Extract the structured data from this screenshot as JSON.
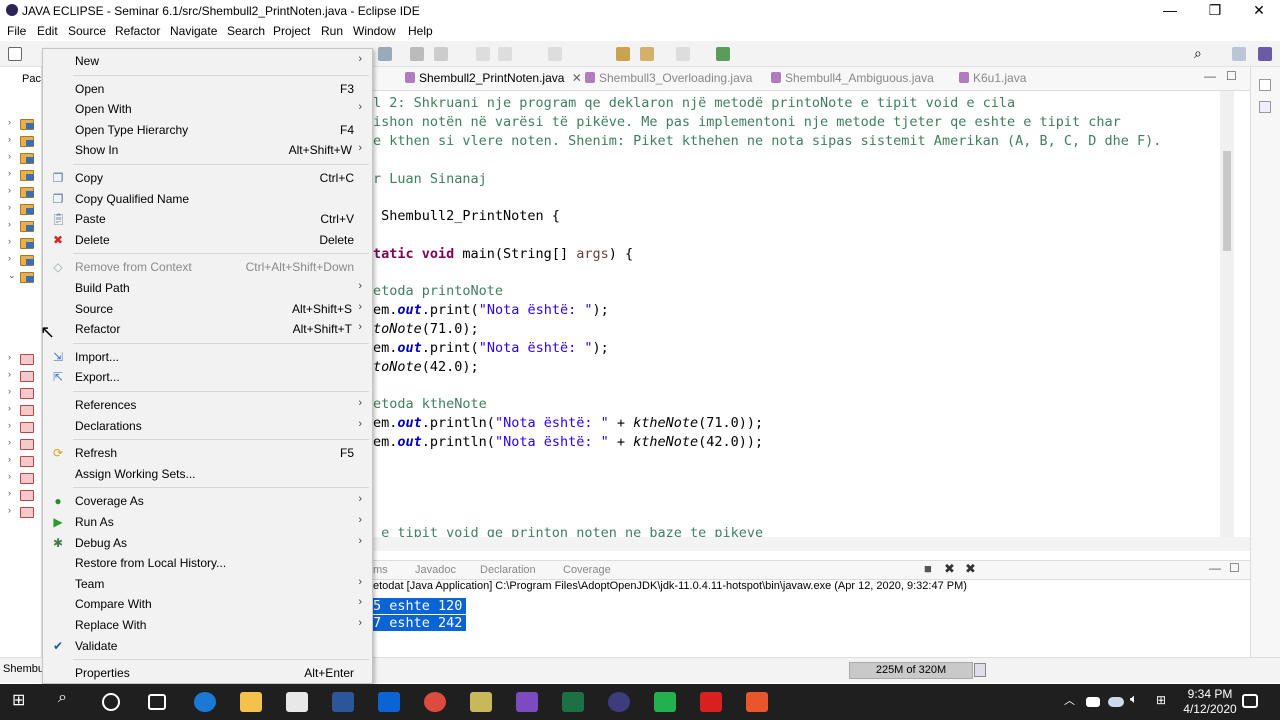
{
  "window": {
    "title": "JAVA ECLIPSE - Seminar 6.1/src/Shembull2_PrintNoten.java - Eclipse IDE",
    "minimize": "—",
    "restore": "❐",
    "close": "✕"
  },
  "menubar": [
    "File",
    "Edit",
    "Source",
    "Refactor",
    "Navigate",
    "Search",
    "Project",
    "Run",
    "Window",
    "Help"
  ],
  "left_panel": {
    "tab_label": "Pac",
    "status_label": "Shembu"
  },
  "editor_tabs": [
    {
      "label": "Shembull2_PrintNoten.java",
      "close": "✕"
    },
    {
      "label": "Shembull3_Overloading.java"
    },
    {
      "label": "Shembull4_Ambiguous.java"
    },
    {
      "label": "K6u1.java"
    }
  ],
  "code": {
    "line1": "l 2: Shkruani nje program qe deklaron një metodë printoNote e tipit void e cila",
    "line2": "ishon notën në varësi të pikëve. Me pas implementoni nje metode tjeter qe eshte e tipit char",
    "line3": "e kthen si vlere noten. Shenim: Piket kthehen ne nota sipas sistemit Amerikan (A, B, C, D dhe F).",
    "author": "r Luan Sinanaj",
    "class_decl": " Shembull2_PrintNoten {",
    "main_kw": "tatic void",
    "main_rest": " main(String[] ",
    "main_args": "args",
    "main_end": ") {",
    "comment1": "etoda printoNote",
    "sys1_a": "em.",
    "sys1_out": "out",
    "sys1_b": ".print(",
    "sys1_str": "\"Nota është: \"",
    "sys1_c": ");",
    "call1_name": "toNote",
    "call1_args": "(71.0);",
    "sys2_a": "em.",
    "sys2_out": "out",
    "sys2_b": ".print(",
    "sys2_str": "\"Nota është: \"",
    "sys2_c": ");",
    "call2_name": "toNote",
    "call2_args": "(42.0);",
    "comment2": "etoda ktheNote",
    "sys3_a": "em.",
    "sys3_out": "out",
    "sys3_b": ".println(",
    "sys3_str": "\"Nota është: \"",
    "sys3_c": " + ",
    "sys3_fn": "ktheNote",
    "sys3_d": "(71.0));",
    "sys4_a": "em.",
    "sys4_out": "out",
    "sys4_b": ".println(",
    "sys4_str": "\"Nota është: \"",
    "sys4_c": " + ",
    "sys4_fn": "ktheNote",
    "sys4_d": "(42.0));",
    "partial_bottom": " e tipit void qe printon noten ne baze te pikeve"
  },
  "console_tabs": [
    "ms",
    "Javadoc",
    "Declaration",
    "Coverage"
  ],
  "console_header": "etodat [Java Application] C:\\Program Files\\AdoptOpenJDK\\jdk-11.0.4.11-hotspot\\bin\\javaw.exe (Apr 12, 2020, 9:32:47 PM)",
  "console_lines": [
    "5 eshte 120",
    "7 eshte 242"
  ],
  "memory": "225M of 320M",
  "context_menu": [
    {
      "label": "New",
      "accel": "",
      "submenu": true,
      "icon": ""
    },
    {
      "sep": true
    },
    {
      "label": "Open",
      "accel": "F3",
      "submenu": false,
      "icon": ""
    },
    {
      "label": "Open With",
      "accel": "",
      "submenu": true,
      "icon": ""
    },
    {
      "label": "Open Type Hierarchy",
      "accel": "F4",
      "submenu": false,
      "icon": ""
    },
    {
      "label": "Show In",
      "accel": "Alt+Shift+W",
      "submenu": true,
      "icon": ""
    },
    {
      "sep": true
    },
    {
      "label": "Copy",
      "accel": "Ctrl+C",
      "submenu": false,
      "icon": "copy-icon"
    },
    {
      "label": "Copy Qualified Name",
      "accel": "",
      "submenu": false,
      "icon": "copy-qualified-icon"
    },
    {
      "label": "Paste",
      "accel": "Ctrl+V",
      "submenu": false,
      "icon": "paste-icon"
    },
    {
      "label": "Delete",
      "accel": "Delete",
      "submenu": false,
      "icon": "delete-icon"
    },
    {
      "sep": true
    },
    {
      "label": "Remove from Context",
      "accel": "Ctrl+Alt+Shift+Down",
      "submenu": false,
      "icon": "remove-context-icon",
      "disabled": true
    },
    {
      "label": "Build Path",
      "accel": "",
      "submenu": true,
      "icon": ""
    },
    {
      "label": "Source",
      "accel": "Alt+Shift+S",
      "submenu": true,
      "icon": ""
    },
    {
      "label": "Refactor",
      "accel": "Alt+Shift+T",
      "submenu": true,
      "icon": ""
    },
    {
      "sep": true
    },
    {
      "label": "Import...",
      "accel": "",
      "submenu": false,
      "icon": "import-icon"
    },
    {
      "label": "Export...",
      "accel": "",
      "submenu": false,
      "icon": "export-icon"
    },
    {
      "sep": true
    },
    {
      "label": "References",
      "accel": "",
      "submenu": true,
      "icon": ""
    },
    {
      "label": "Declarations",
      "accel": "",
      "submenu": true,
      "icon": ""
    },
    {
      "sep": true
    },
    {
      "label": "Refresh",
      "accel": "F5",
      "submenu": false,
      "icon": "refresh-icon"
    },
    {
      "label": "Assign Working Sets...",
      "accel": "",
      "submenu": false,
      "icon": ""
    },
    {
      "sep": true
    },
    {
      "label": "Coverage As",
      "accel": "",
      "submenu": true,
      "icon": "coverage-icon"
    },
    {
      "label": "Run As",
      "accel": "",
      "submenu": true,
      "icon": "run-icon"
    },
    {
      "label": "Debug As",
      "accel": "",
      "submenu": true,
      "icon": "debug-icon"
    },
    {
      "label": "Restore from Local History...",
      "accel": "",
      "submenu": false,
      "icon": ""
    },
    {
      "label": "Team",
      "accel": "",
      "submenu": true,
      "icon": ""
    },
    {
      "label": "Compare With",
      "accel": "",
      "submenu": true,
      "icon": ""
    },
    {
      "label": "Replace With",
      "accel": "",
      "submenu": true,
      "icon": ""
    },
    {
      "label": "Validate",
      "accel": "",
      "submenu": false,
      "icon": "validate-check-icon"
    },
    {
      "sep": true
    },
    {
      "label": "Properties",
      "accel": "Alt+Enter",
      "submenu": false,
      "icon": ""
    }
  ],
  "clock": {
    "time": "9:34 PM",
    "date": "4/12/2020"
  },
  "colors": {
    "selection": "#0a64d6",
    "comment": "#3f7f5f",
    "keyword": "#7f0055",
    "string": "#2a00ff",
    "field": "#0000c0"
  }
}
